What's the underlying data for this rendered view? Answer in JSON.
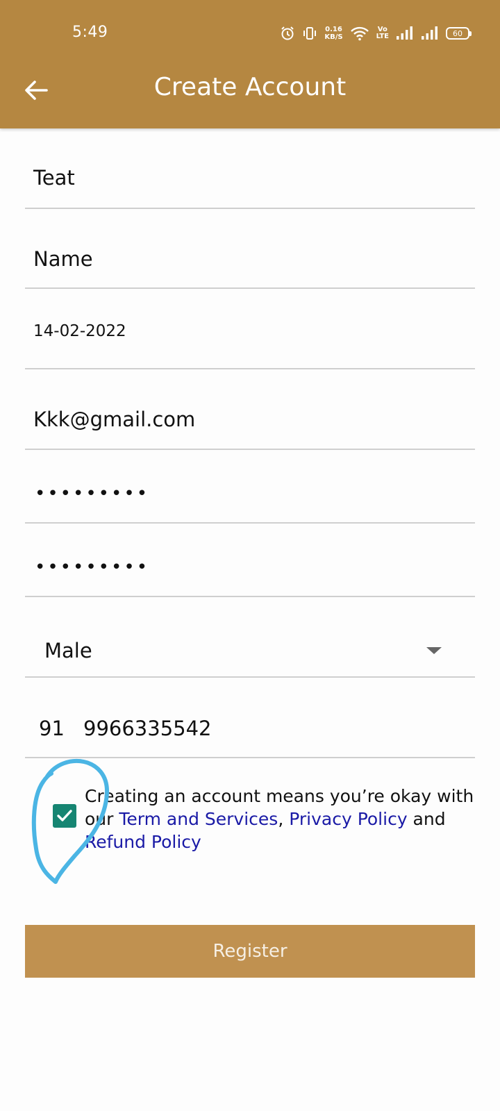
{
  "status_bar": {
    "time": "5:49",
    "net_speed_value": "0.16",
    "net_speed_unit": "KB/S",
    "volte_top": "Vo",
    "volte_bottom": "LTE",
    "battery": "60",
    "icons": [
      "alarm-icon",
      "vibrate-icon",
      "wifi-icon",
      "signal-icon",
      "signal-icon",
      "battery-icon"
    ]
  },
  "header": {
    "title": "Create Account",
    "back_icon": "arrow-left-icon",
    "background_color": "#b58741"
  },
  "form": {
    "first_name": "Teat",
    "last_name": "Name",
    "date_of_birth": "14-02-2022",
    "email": "Kkk@gmail.com",
    "password": "•••••••••",
    "confirm_password": "•••••••••",
    "gender": "Male",
    "country_code": "91",
    "phone": "9966335542"
  },
  "terms": {
    "checked": true,
    "text_before": "Creating an account means you’re okay with our ",
    "terms_link": "Term and Services",
    "separator": ",  ",
    "privacy_link": "Privacy Policy",
    "and_text": " and  ",
    "refund_link": "Refund Policy",
    "checkbox_color": "#168572",
    "link_color": "#1a1aa6"
  },
  "actions": {
    "register_label": "Register",
    "register_color": "#c09150"
  }
}
